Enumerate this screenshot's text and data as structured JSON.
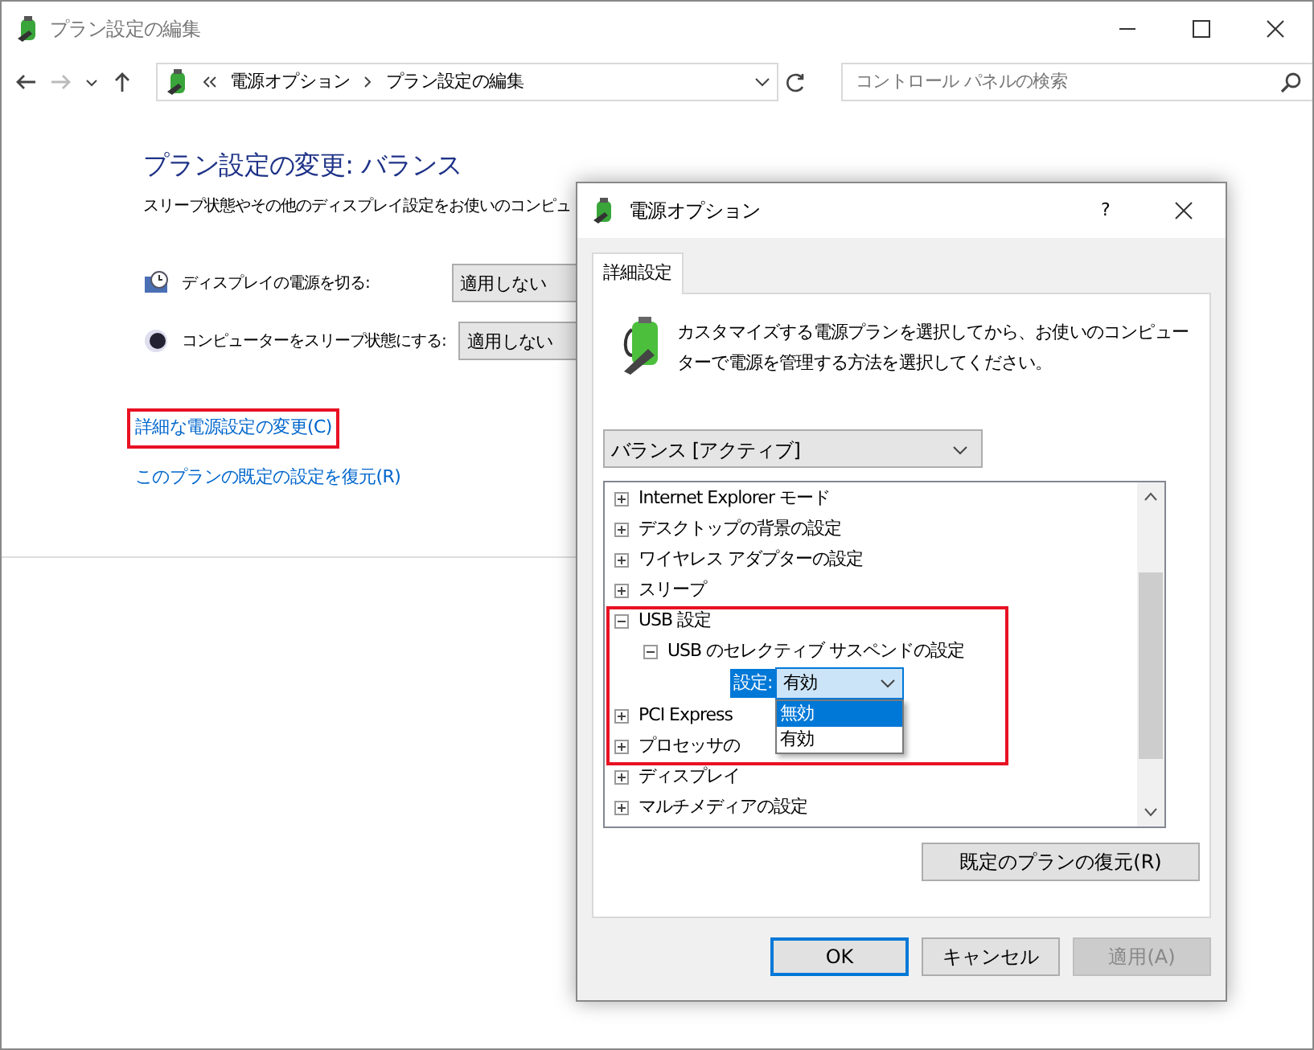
{
  "window": {
    "title": "プラン設定の編集"
  },
  "address": {
    "crumbs": [
      "電源オプション",
      "プラン設定の編集"
    ],
    "search_placeholder": "コントロール パネルの検索"
  },
  "main": {
    "heading": "プラン設定の変更: バランス",
    "description": "スリープ状態やその他のディスプレイ設定をお使いのコンピュ",
    "settings": [
      {
        "kind": "display",
        "label": "ディスプレイの電源を切る:",
        "value": "適用しない"
      },
      {
        "kind": "sleep",
        "label": "コンピューターをスリープ状態にする:",
        "value": "適用しない"
      }
    ],
    "links": [
      {
        "label": "詳細な電源設定の変更(C)",
        "highlighted": true
      },
      {
        "label": "このプランの既定の設定を復元(R)",
        "highlighted": false
      }
    ]
  },
  "dialog": {
    "title": "電源オプション",
    "help": "?",
    "tabs": [
      {
        "label": "詳細設定",
        "selected": true
      }
    ],
    "intro": "カスタマイズする電源プランを選択してから、お使いのコンピューターで電源を管理する方法を選択してください。",
    "plan": "バランス [アクティブ]",
    "tree": [
      {
        "label": "Internet Explorer モード",
        "expanded": false
      },
      {
        "label": "デスクトップの背景の設定",
        "expanded": false
      },
      {
        "label": "ワイヤレス アダプターの設定",
        "expanded": false
      },
      {
        "label": "スリープ",
        "expanded": false
      },
      {
        "label": "USB 設定",
        "expanded": true,
        "highlighted": true,
        "children": [
          {
            "label": "USB のセレクティブ サスペンドの設定",
            "expanded": true,
            "setting": {
              "label": "設定:",
              "value": "有効",
              "options": [
                {
                  "label": "無効",
                  "highlighted": true
                },
                {
                  "label": "有効",
                  "highlighted": false
                }
              ]
            }
          }
        ]
      },
      {
        "label": "PCI Express",
        "expanded": false
      },
      {
        "label": "プロセッサの",
        "expanded": false
      },
      {
        "label": "ディスプレイ",
        "expanded": false
      },
      {
        "label": "マルチメディアの設定",
        "expanded": false
      }
    ],
    "restore_button": "既定のプランの復元(R)",
    "buttons": [
      {
        "label": "OK",
        "kind": "default",
        "disabled": false
      },
      {
        "label": "キャンセル",
        "kind": "normal",
        "disabled": false
      },
      {
        "label": "適用(A)",
        "kind": "normal",
        "disabled": true
      }
    ]
  }
}
